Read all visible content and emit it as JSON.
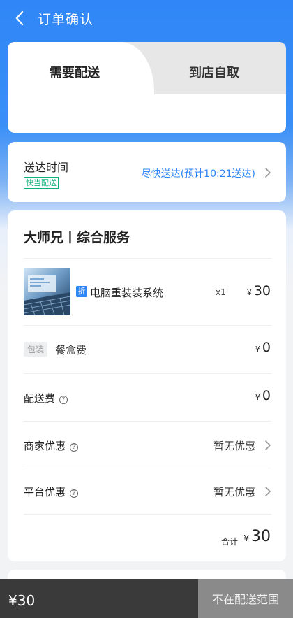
{
  "header": {
    "title": "订单确认"
  },
  "delivery_mode": {
    "tab_delivery": "需要配送",
    "tab_pickup": "到店自取"
  },
  "delivery_time": {
    "label": "送达时间",
    "badge": "快当配送",
    "value": "尽快送达(预计10:21送达)"
  },
  "order": {
    "shop_name": "大师兄丨综合服务",
    "product": {
      "discount_tag": "折",
      "name": "电脑重装装系统",
      "qty": "x1",
      "currency": "¥",
      "price": "30"
    },
    "packaging": {
      "badge": "包装",
      "label": "餐盒费",
      "currency": "¥",
      "price": "0"
    },
    "delivery_fee": {
      "label": "配送费",
      "help": "?",
      "currency": "¥",
      "price": "0"
    },
    "merchant_discount": {
      "label": "商家优惠",
      "help": "?",
      "value": "暂无优惠"
    },
    "platform_discount": {
      "label": "平台优惠",
      "help": "?",
      "value": "暂无优惠"
    },
    "total": {
      "label": "合计",
      "currency": "¥",
      "price": "30"
    }
  },
  "bottom_bar": {
    "total": "¥30",
    "action": "不在配送范围"
  },
  "colors": {
    "primary": "#2f86f6",
    "green": "#13b07c",
    "bar_dark": "#3a3a3a",
    "bar_disabled": "#8a8a8a"
  }
}
